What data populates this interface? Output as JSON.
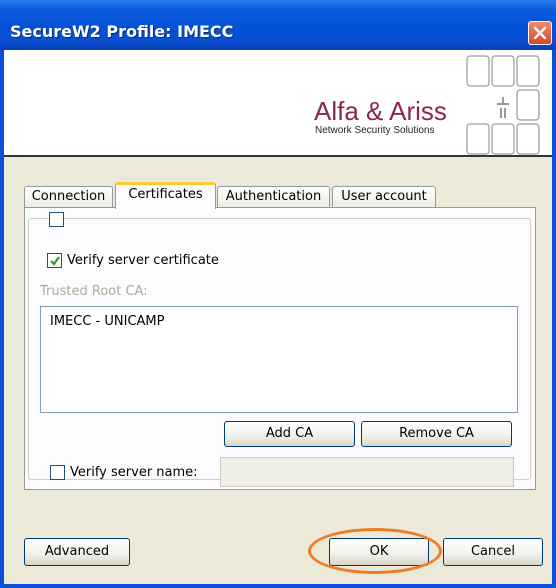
{
  "window": {
    "title": "SecureW2 Profile: IMECC"
  },
  "banner": {
    "brand_name": "Alfa & Ariss",
    "brand_tagline": "Network Security Solutions"
  },
  "tabs": [
    {
      "label": "Connection",
      "active": false
    },
    {
      "label": "Certificates",
      "active": true
    },
    {
      "label": "Authentication",
      "active": false
    },
    {
      "label": "User account",
      "active": false
    }
  ],
  "certificates": {
    "verify_server_certificate": {
      "label": "Verify server certificate",
      "checked": true
    },
    "trusted_root_ca_label": "Trusted Root CA:",
    "trusted_root_ca_items": [
      "IMECC - UNICAMP"
    ],
    "add_ca_label": "Add CA",
    "remove_ca_label": "Remove CA",
    "verify_server_name": {
      "label": "Verify server name:",
      "checked": false,
      "value": ""
    }
  },
  "footer": {
    "advanced_label": "Advanced",
    "ok_label": "OK",
    "cancel_label": "Cancel"
  },
  "colors": {
    "title_bar": "#0a50d8",
    "brand": "#8c2846",
    "highlight_ring": "#f07c24"
  }
}
